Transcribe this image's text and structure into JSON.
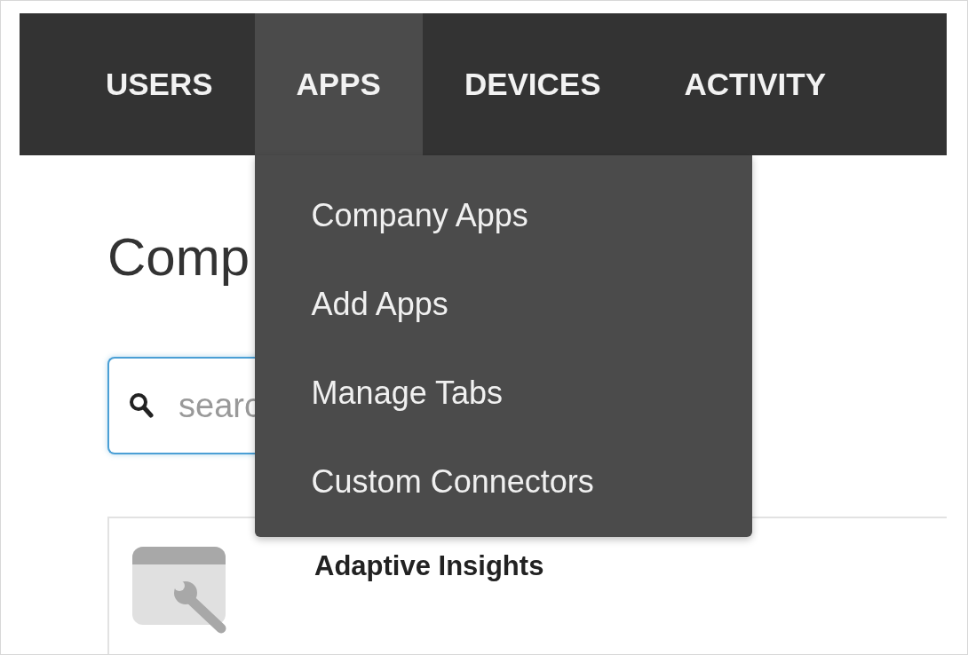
{
  "nav": {
    "tabs": [
      {
        "label": "USERS",
        "selected": false
      },
      {
        "label": "APPS",
        "selected": true
      },
      {
        "label": "DEVICES",
        "selected": false
      },
      {
        "label": "ACTIVITY",
        "selected": false
      }
    ]
  },
  "dropdown": {
    "items": [
      "Company Apps",
      "Add Apps",
      "Manage Tabs",
      "Custom Connectors"
    ]
  },
  "page": {
    "title": "Comp",
    "search": {
      "placeholder": "searc"
    }
  },
  "apps": [
    {
      "name": "Adaptive Insights"
    }
  ]
}
